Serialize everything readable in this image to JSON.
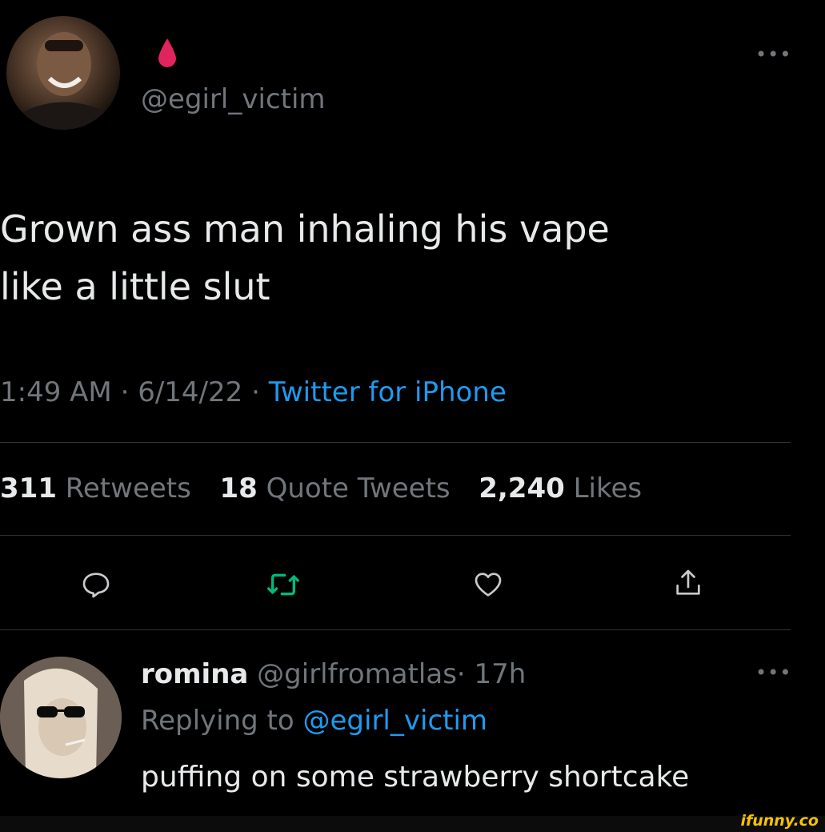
{
  "tweet": {
    "handle": "@egirl_victim",
    "text_line1": "Grown ass man inhaling his vape",
    "text_line2": "like a little slut",
    "time": "1:49 AM",
    "date": "6/14/22",
    "source": "Twitter for iPhone",
    "sep": "·"
  },
  "stats": {
    "retweets_count": "311",
    "retweets_label": "Retweets",
    "quotes_count": "18",
    "quotes_label": "Quote Tweets",
    "likes_count": "2,240",
    "likes_label": "Likes"
  },
  "reply": {
    "name": "romina",
    "handle": "@girlfromatlas",
    "time": "· 17h",
    "replying_to_label": "Replying to",
    "replying_to_handle": "@egirl_victim",
    "text": "puffing on some strawberry shortcake"
  },
  "watermark": "ifunny.co",
  "icons": {
    "drop": "blood-drop-icon",
    "more": "more-icon",
    "reply": "reply-icon",
    "retweet": "retweet-icon",
    "like": "heart-icon",
    "share": "share-icon"
  },
  "colors": {
    "background": "#000000",
    "text": "#e7e9ea",
    "secondary": "#71767b",
    "link": "#1d9bf0",
    "retweet": "#00ba7c",
    "drop": "#e0245e",
    "watermark": "#f5c300"
  }
}
